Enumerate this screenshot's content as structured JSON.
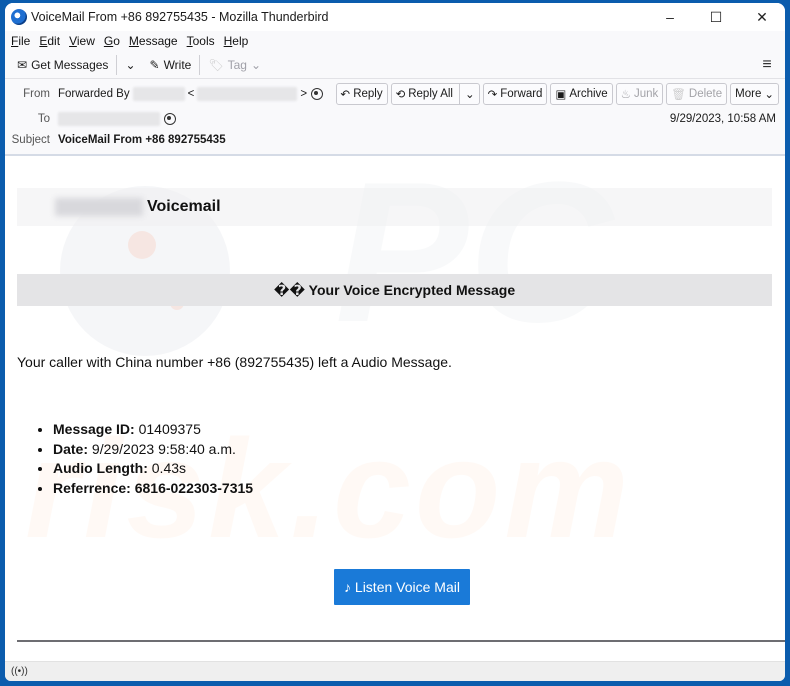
{
  "window": {
    "title": "VoiceMail From +86 892755435 - Mozilla Thunderbird",
    "controls": {
      "minimize": "–",
      "maximize": "☐",
      "close": "✕"
    }
  },
  "menubar": {
    "items": [
      {
        "accel": "F",
        "rest": "ile"
      },
      {
        "accel": "E",
        "rest": "dit"
      },
      {
        "accel": "V",
        "rest": "iew"
      },
      {
        "accel": "G",
        "rest": "o"
      },
      {
        "accel": "M",
        "rest": "essage"
      },
      {
        "accel": "T",
        "rest": "ools"
      },
      {
        "accel": "H",
        "rest": "elp"
      }
    ]
  },
  "toolbar": {
    "get_messages": "Get Messages",
    "write": "Write",
    "tag": "Tag",
    "icons": {
      "get_messages": "✉",
      "dropdown": "⌄",
      "write": "✎",
      "tag": "🏷",
      "menu": "≡"
    }
  },
  "header": {
    "from_label": "From",
    "from_value": "Forwarded By",
    "to_label": "To",
    "subject_label": "Subject",
    "subject_value": "VoiceMail From +86 892755435",
    "date": "9/29/2023, 10:58 AM",
    "buttons": {
      "reply": "Reply",
      "reply_all": "Reply All",
      "forward": "Forward",
      "archive": "Archive",
      "junk": "Junk",
      "delete": "Delete",
      "more": "More"
    },
    "button_icons": {
      "reply": "↶",
      "reply_all": "⟲",
      "forward": "↷",
      "archive": "▣",
      "junk": "♨",
      "delete": "🗑",
      "chevron": "⌄"
    }
  },
  "email": {
    "brand_title": "Voicemail",
    "encrypted_heading": "�� Your Voice Encrypted Message",
    "caller_line": "Your caller with China number +86 (892755435) left a Audio Message.",
    "details": [
      {
        "label": "Message ID:",
        "value": " 01409375",
        "value_bold": false
      },
      {
        "label": "Date:",
        "value": " 9/29/2023 9:58:40 a.m.",
        "value_bold": false
      },
      {
        "label": "Audio Length:",
        "value": " 0.43s",
        "value_bold": false
      },
      {
        "label": "Referrence:",
        "value": " 6816-022303-7315",
        "value_bold": true
      }
    ],
    "listen_button": "♪ Listen Voice Mail",
    "colors": {
      "button_bg": "#1a7ad8",
      "band_bg": "#e4e4e6"
    }
  },
  "watermark": {
    "text_bottom": "risk.com",
    "text_top": "PC"
  },
  "statusbar": {
    "icon": "((•))"
  }
}
